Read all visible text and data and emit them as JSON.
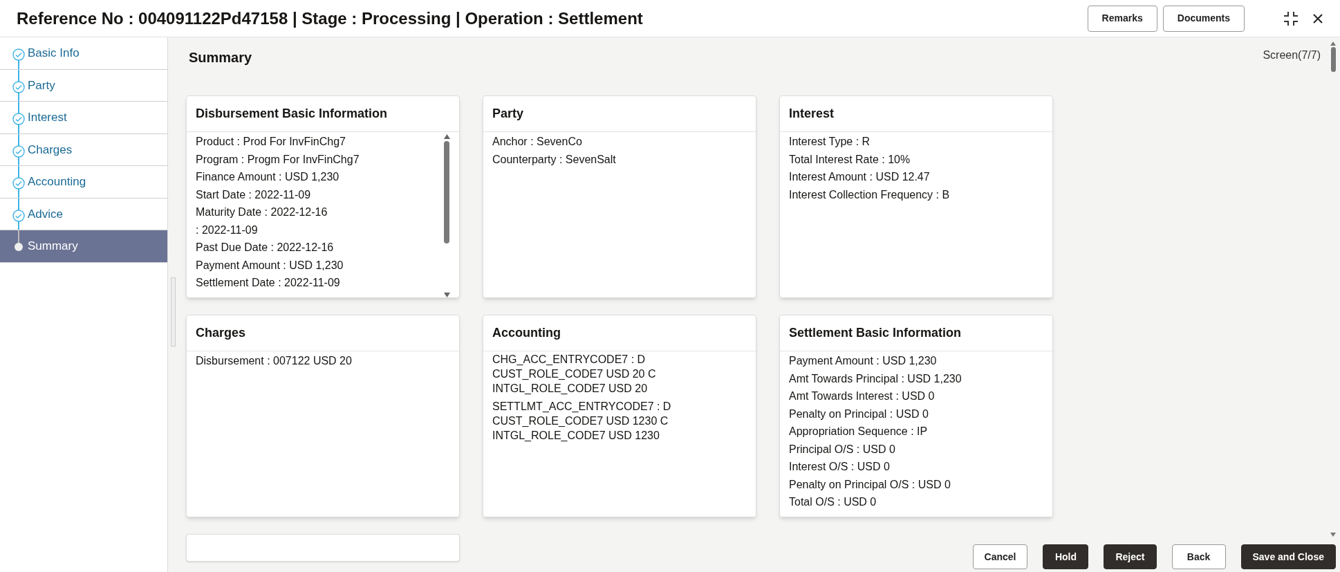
{
  "header": {
    "title": "Reference No : 004091122Pd47158 | Stage : Processing | Operation : Settlement",
    "buttons": [
      "Remarks",
      "Documents"
    ]
  },
  "steps": [
    {
      "label": "Basic Info",
      "selected": false
    },
    {
      "label": "Party",
      "selected": false
    },
    {
      "label": "Interest",
      "selected": false
    },
    {
      "label": "Charges",
      "selected": false
    },
    {
      "label": "Accounting",
      "selected": false
    },
    {
      "label": "Advice",
      "selected": false
    },
    {
      "label": "Summary",
      "selected": true
    }
  ],
  "page": {
    "title": "Summary",
    "screen": "Screen(7/7)"
  },
  "cards": [
    {
      "kind": "lines",
      "title": "Disbursement Basic Information",
      "scrollable": true,
      "lines": [
        "Product : Prod For InvFinChg7",
        "Program : Progm For InvFinChg7",
        "Finance Amount : USD 1,230",
        "Start Date : 2022-11-09",
        "Maturity Date : 2022-12-16",
        ": 2022-11-09",
        "Past Due Date : 2022-12-16",
        "Payment Amount : USD 1,230",
        "Settlement Date : 2022-11-09"
      ]
    },
    {
      "kind": "lines",
      "title": "Party",
      "scrollable": false,
      "lines": [
        "Anchor : SevenCo",
        "Counterparty : SevenSalt"
      ]
    },
    {
      "kind": "lines",
      "title": "Interest",
      "scrollable": false,
      "lines": [
        "Interest Type : R",
        "Total Interest Rate : 10%",
        "Interest Amount : USD 12.47",
        "Interest Collection Frequency : B"
      ]
    },
    {
      "kind": "lines",
      "title": "Charges",
      "scrollable": false,
      "lines": [
        "Disbursement : 007122 USD 20"
      ]
    },
    {
      "kind": "groups",
      "title": "Accounting",
      "groups": [
        [
          "CHG_ACC_ENTRYCODE7 : D",
          "CUST_ROLE_CODE7 USD 20 C",
          "INTGL_ROLE_CODE7 USD 20"
        ],
        [
          "SETTLMT_ACC_ENTRYCODE7 : D",
          "CUST_ROLE_CODE7 USD 1230 C",
          "INTGL_ROLE_CODE7 USD 1230"
        ]
      ]
    },
    {
      "kind": "lines",
      "title": "Settlement Basic Information",
      "scrollable": false,
      "lines": [
        "Payment Amount : USD 1,230",
        "Amt Towards Principal : USD 1,230",
        "Amt Towards Interest : USD 0",
        "Penalty on Principal : USD 0",
        "Appropriation Sequence : IP",
        "Principal O/S : USD 0",
        "Interest O/S : USD 0",
        "Penalty on Principal O/S : USD 0",
        "Total O/S : USD 0"
      ]
    },
    {
      "kind": "blank"
    }
  ],
  "footer_buttons": [
    {
      "label": "Cancel",
      "kind": "secondary"
    },
    {
      "label": "Hold",
      "kind": "primary"
    },
    {
      "label": "Reject",
      "kind": "primary"
    },
    {
      "label": "Back",
      "kind": "secondary"
    },
    {
      "label": "Save and Close",
      "kind": "primary"
    }
  ]
}
